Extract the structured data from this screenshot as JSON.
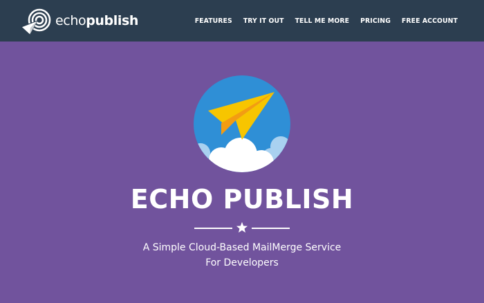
{
  "brand": {
    "logo_icon": "target-paper-plane-icon",
    "name_light": "echo",
    "name_bold": "publish"
  },
  "nav": {
    "items": [
      {
        "label": "FEATURES"
      },
      {
        "label": "TRY IT OUT"
      },
      {
        "label": "TELL ME MORE"
      },
      {
        "label": "PRICING"
      },
      {
        "label": "FREE ACCOUNT"
      }
    ]
  },
  "hero": {
    "emblem_icon": "paper-plane-clouds-icon",
    "title": "ECHO PUBLISH",
    "divider_icon": "star-icon",
    "subtitle_line1": "A Simple Cloud-Based MailMerge Service",
    "subtitle_line2": "For Developers"
  },
  "colors": {
    "navbar_bg": "#2c3e50",
    "hero_bg": "#71539d",
    "emblem_sky": "#2f8fd6",
    "plane_yellow": "#f7c500",
    "plane_orange": "#f39c12",
    "cloud": "#ffffff",
    "cloud_back": "#a9d1f0"
  }
}
